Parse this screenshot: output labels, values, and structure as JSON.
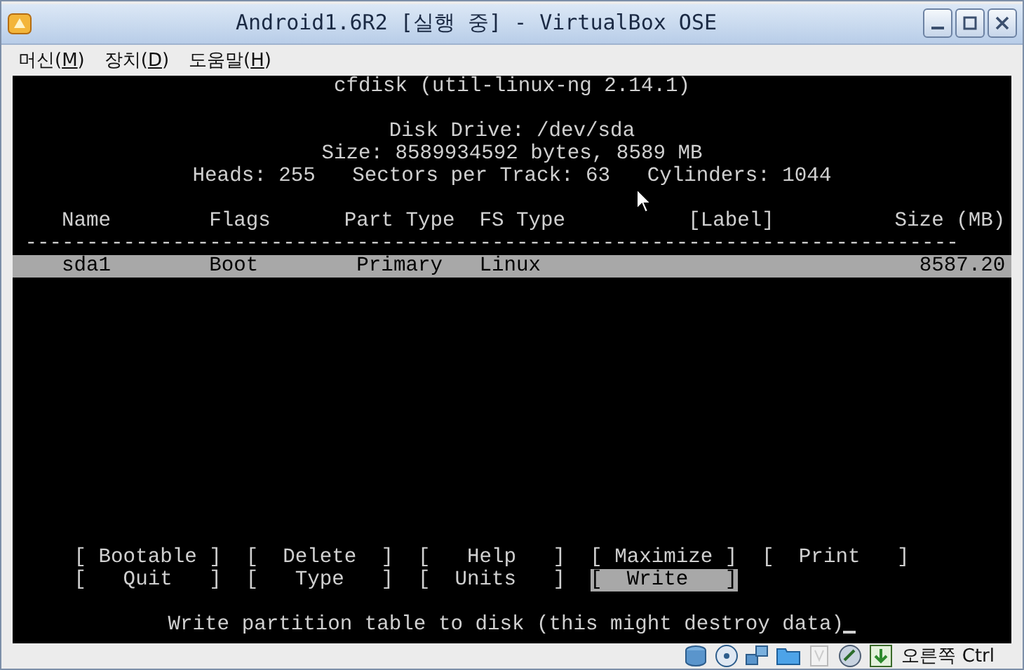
{
  "window": {
    "title": "Android1.6R2 [실행 중] - VirtualBox OSE"
  },
  "menu": [
    {
      "before": "머신(",
      "key": "M",
      "after": ")"
    },
    {
      "before": "장치(",
      "key": "D",
      "after": ")"
    },
    {
      "before": "도움말(",
      "key": "H",
      "after": ")"
    }
  ],
  "terminal": {
    "heading": "cfdisk (util-linux-ng 2.14.1)",
    "disk_info": [
      "Disk Drive: /dev/sda",
      "Size: 8589934592 bytes, 8589 MB",
      "Heads: 255   Sectors per Track: 63   Cylinders: 1044"
    ],
    "columns": [
      "Name",
      "Flags",
      "Part Type",
      "FS Type",
      "[Label]",
      "Size (MB)"
    ],
    "separator": "----------------------------------------------------------------------------",
    "partitions": [
      {
        "selected": true,
        "cells": [
          "sda1",
          "Boot",
          "Primary",
          "Linux",
          "",
          "8587.20"
        ]
      }
    ],
    "buttons": [
      {
        "label": "[ Bootable ]",
        "selected": false
      },
      {
        "label": "[  Delete  ]",
        "selected": false
      },
      {
        "label": "[   Help   ]",
        "selected": false
      },
      {
        "label": "[ Maximize ]",
        "selected": false
      },
      {
        "label": "[  Print   ]",
        "selected": false
      },
      {
        "label": "[   Quit   ]",
        "selected": false
      },
      {
        "label": "[   Type   ]",
        "selected": false
      },
      {
        "label": "[  Units   ]",
        "selected": false
      },
      {
        "label": "[  Write   ]",
        "selected": true
      }
    ],
    "message": "Write partition table to disk (this might destroy data)"
  },
  "status_bar": {
    "host_key": "오른쪽 Ctrl"
  }
}
